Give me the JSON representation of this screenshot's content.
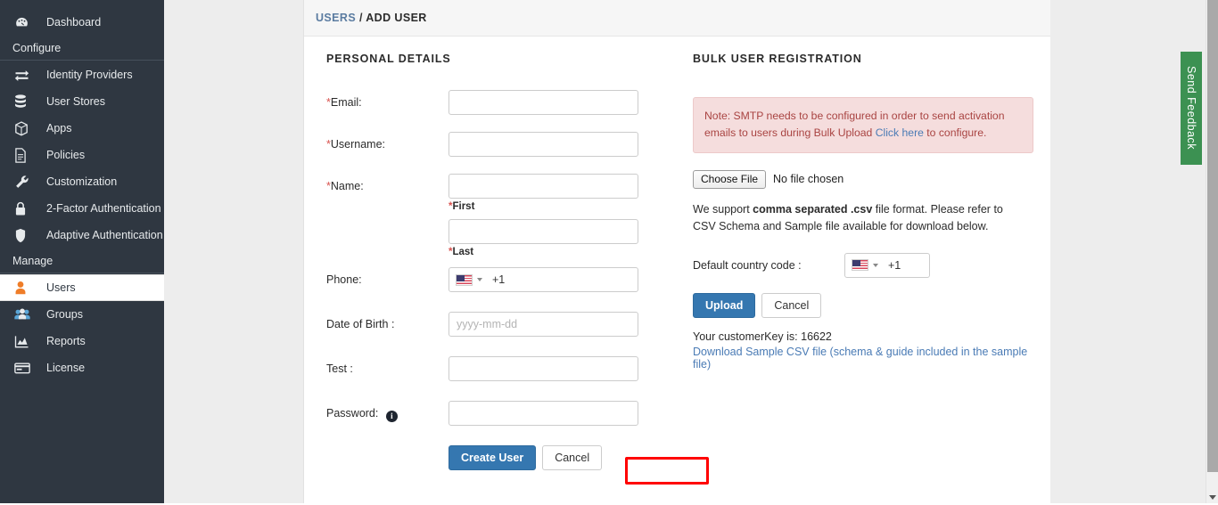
{
  "sidebar": {
    "top_items": [
      {
        "label": "Dashboard",
        "icon": "dashboard-icon"
      }
    ],
    "sections": [
      {
        "title": "Configure",
        "items": [
          {
            "label": "Identity Providers",
            "icon": "exchange-icon"
          },
          {
            "label": "User Stores",
            "icon": "database-icon"
          },
          {
            "label": "Apps",
            "icon": "cube-icon"
          },
          {
            "label": "Policies",
            "icon": "document-icon"
          },
          {
            "label": "Customization",
            "icon": "wrench-icon"
          },
          {
            "label": "2-Factor Authentication",
            "icon": "lock-icon"
          },
          {
            "label": "Adaptive Authentication",
            "icon": "shield-icon"
          }
        ]
      },
      {
        "title": "Manage",
        "items": [
          {
            "label": "Users",
            "icon": "user-icon",
            "active": true
          },
          {
            "label": "Groups",
            "icon": "users-group-icon"
          },
          {
            "label": "Reports",
            "icon": "chart-icon"
          },
          {
            "label": "License",
            "icon": "card-icon"
          }
        ]
      }
    ]
  },
  "breadcrumb": {
    "parent": "USERS",
    "separator": "/",
    "current": "ADD USER"
  },
  "personal_details": {
    "title": "PERSONAL DETAILS",
    "fields": {
      "email_label": "*Email:",
      "email_value": "",
      "username_label": "*Username:",
      "username_value": "",
      "name_label": "*Name:",
      "first_value": "",
      "first_sublabel": "*First",
      "last_value": "",
      "last_sublabel": "*Last",
      "phone_label": "Phone:",
      "phone_dialcode": "+1",
      "phone_flag": "us-flag-icon",
      "dob_label": "Date of Birth :",
      "dob_placeholder": "yyyy-mm-dd",
      "dob_value": "",
      "test_label": "Test :",
      "test_value": "",
      "password_label": "Password:",
      "password_info_icon": "info-icon",
      "password_value": ""
    },
    "create_button": "Create User",
    "cancel_button": "Cancel"
  },
  "bulk_registration": {
    "title": "BULK USER REGISTRATION",
    "note_prefix": "Note: SMTP needs to be configured in order to send activation emails to users during Bulk Upload ",
    "note_link": "Click here",
    "note_suffix": " to configure.",
    "choose_file_button": "Choose File",
    "no_file_text": "No file chosen",
    "help_prefix": "We support ",
    "help_bold": "comma separated .csv",
    "help_suffix": " file format. Please refer to CSV Schema and Sample file available for download below.",
    "country_code_label": "Default country code :",
    "country_code_value": "+1",
    "country_flag": "us-flag-icon",
    "upload_button": "Upload",
    "cancel_button": "Cancel",
    "customer_key_line": "Your customerKey is: 16622",
    "download_link": "Download Sample CSV file (schema & guide included in the sample file)"
  },
  "feedback_tab": {
    "label": "Send Feedback"
  },
  "colors": {
    "sidebar_bg": "#2f3741",
    "accent_blue": "#3577b0",
    "link_blue": "#4a7bb5",
    "highlight_red": "#ff0000",
    "feedback_green": "#3c9152",
    "alert_bg": "#f5dddd",
    "alert_text": "#a94442",
    "user_icon_orange": "#ef7d28"
  }
}
